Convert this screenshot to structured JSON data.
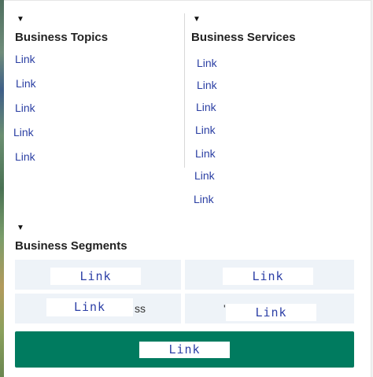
{
  "business_topics": {
    "heading": "Business Topics",
    "links": [
      "Link",
      "Link",
      "Link",
      "Link",
      "Link"
    ]
  },
  "business_services": {
    "heading": "Business Services",
    "links": [
      "Link",
      "Link",
      "Link",
      "Link",
      "Link",
      "Link",
      "Link"
    ]
  },
  "business_segments": {
    "heading": "Business Segments",
    "tiles": [
      {
        "label": "Link"
      },
      {
        "label": "Link"
      },
      {
        "label": "Link",
        "stub": "ss"
      },
      {
        "label": "Link",
        "stub": "'"
      }
    ]
  },
  "cta": {
    "label": "Link"
  },
  "icons": {
    "caret": "▼"
  },
  "colors": {
    "link": "#2b3fa3",
    "cta_background": "#007b5f",
    "tile_background": "#eef3f8"
  }
}
